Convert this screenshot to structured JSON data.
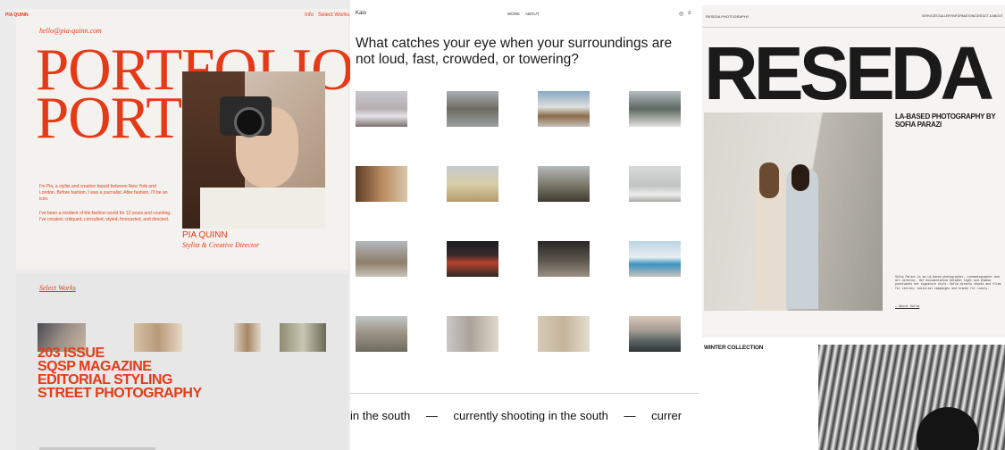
{
  "panel1": {
    "brand": "PIA QUINN",
    "nav": [
      "Info",
      "Select Works"
    ],
    "email": "hello@pia-quinn.com",
    "headline1": "PORTFOLIO",
    "headline2": "PORT",
    "bio1": "I'm Pia, a stylist and creative based between New York and London. Before fashion, I was a journalist. After fashion, I'll be an icon.",
    "bio2": "I've been a resident of the fashion world for 12 years and counting. I've created, critiqued, consulted, styled, forecasted, and directed.",
    "name": "PIA QUINN",
    "role": "Stylist & Creative Director",
    "select_works": "Select Works",
    "works": [
      "203 ISSUE",
      "SQSP MAGAZINE",
      "EDITORIAL STYLING",
      "STREET PHOTOGRAPHY"
    ]
  },
  "panel2": {
    "logo": "Kaio",
    "nav": [
      "WORK",
      "ABOUT"
    ],
    "question": "What catches your eye when your surroundings are not loud, fast, crowded, or towering?",
    "ticker": [
      "in the south",
      "—",
      "currently shooting in the south",
      "—",
      "currer"
    ]
  },
  "panel3": {
    "brand": "RESEDA PHOTOGRAPHY",
    "nav": [
      "SERVICES",
      "GALLERY",
      "INFORMATION",
      "CONTACT & ABOUT"
    ],
    "title": "RESEDA",
    "tagline": "LA-BASED PHOTOGRAPHY BY SOFIA PARAZI",
    "bio": "Sofia Parazi is an LA-based photographer, cinematographer and art director. Her documentation between light and shadow punctuates her signature style. Sofia directs shoots and films for stories, editorial campaigns and brands for luxury.",
    "link": "— About Sofia",
    "collection": "WINTER COLLECTION"
  },
  "colors": {
    "accent_red": "#e63a17",
    "dark": "#1a1a1a"
  }
}
